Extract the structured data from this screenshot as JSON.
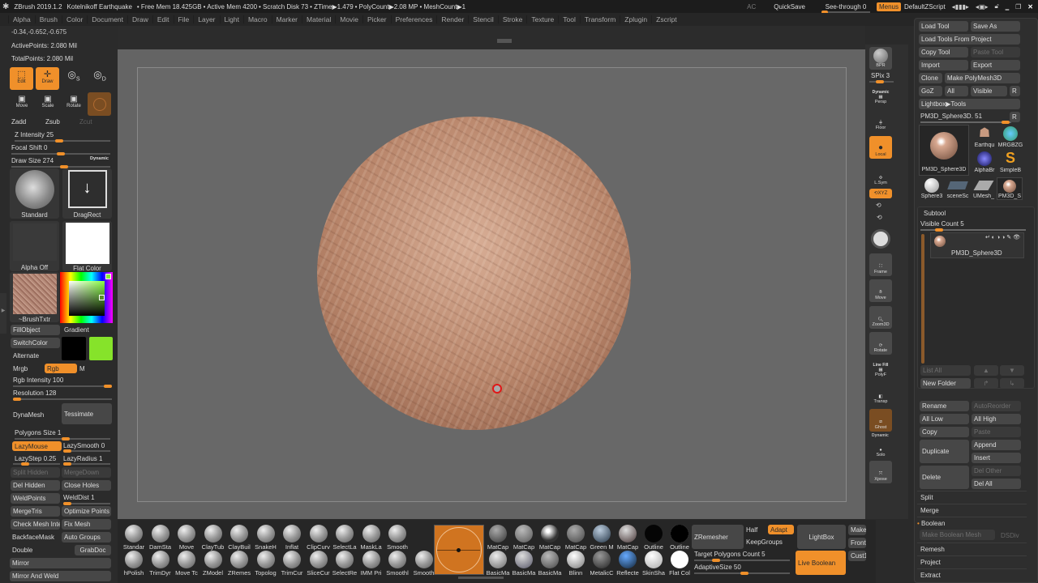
{
  "titlebar": {
    "app": "ZBrush 2019.1.2",
    "document": "Kotelnikoff Earthquake",
    "free_mem": "• Free Mem 18.425GB",
    "active_mem": "• Active Mem 4200",
    "scratch_disk": "• Scratch Disk 73",
    "ztime": "• ZTime▶1.479",
    "polycount": "• PolyCount▶2.08 MP",
    "meshcount": "• MeshCount▶1",
    "ac": "AC",
    "quicksave": "QuickSave",
    "see_through": "See-through  0",
    "see_through_value": 0,
    "menus": "Menus",
    "default_zscript": "DefaultZScript"
  },
  "menubar": [
    "Alpha",
    "Brush",
    "Color",
    "Document",
    "Draw",
    "Edit",
    "File",
    "Layer",
    "Light",
    "Macro",
    "Marker",
    "Material",
    "Movie",
    "Picker",
    "Preferences",
    "Render",
    "Stencil",
    "Stroke",
    "Texture",
    "Tool",
    "Transform",
    "Zplugin",
    "Zscript"
  ],
  "left": {
    "coords": "-0.34,-0.652,-0.675",
    "active_points": "ActivePoints: 2.080 Mil",
    "total_points": "TotalPoints: 2.080 Mil",
    "modes": [
      "Edit",
      "Draw",
      "S",
      "D"
    ],
    "transforms": [
      "Move",
      "Scale",
      "Rotate"
    ],
    "zadd": "Zadd",
    "zsub": "Zsub",
    "zcut": "Zcut",
    "z_intensity": "Z Intensity 25",
    "z_intensity_value": 25,
    "focal_shift": "Focal Shift 0",
    "focal_shift_value": 0,
    "draw_size": "Draw Size 274",
    "draw_size_value": 274,
    "dynamic": "Dynamic",
    "brush_name": "Standard",
    "stroke_name": "DragRect",
    "alpha_name": "Alpha Off",
    "texture_name": "Flat Color",
    "brush_texture": "~BrushTxtr",
    "fill_object": "FillObject",
    "gradient": "Gradient",
    "switch_color": "SwitchColor",
    "alternate": "Alternate",
    "main_color": "#000000",
    "secondary_color": "#86e32a",
    "mrgb": "Mrgb",
    "rgb": "Rgb",
    "m": "M",
    "rgb_intensity": "Rgb Intensity 100",
    "rgb_intensity_value": 100,
    "resolution": "Resolution 128",
    "resolution_value": 128,
    "dynamesh": "DynaMesh",
    "tessimate": "Tessimate",
    "polygons_size": "Polygons Size 1",
    "lazymouse": "LazyMouse",
    "lazysmooth": "LazySmooth 0",
    "lazystep": "LazyStep 0.25",
    "lazyradius": "LazyRadius 1",
    "split_hidden": "Split Hidden",
    "merge_down": "MergeDown",
    "del_hidden": "Del Hidden",
    "close_holes": "Close Holes",
    "weld_points": "WeldPoints",
    "weld_dist": "WeldDist 1",
    "merge_tris": "MergeTris",
    "optimize_points": "Optimize Points",
    "check_mesh": "Check Mesh Inte",
    "fix_mesh": "Fix Mesh",
    "backface_mask": "BackfaceMask",
    "auto_groups": "Auto Groups",
    "double": "Double",
    "grabdoc": "GrabDoc",
    "mirror": "Mirror",
    "mirror_and_weld": "Mirror And Weld"
  },
  "righttools": {
    "bpr": "BPR",
    "spix": "SPix 3",
    "persp": "Persp",
    "persp_dyn": "Dynamic",
    "floor": "Floor",
    "local": "Local",
    "lsym": "L.Sym",
    "xyz": "XYZ",
    "frame": "Frame",
    "move": "Move",
    "zoom3d": "Zoom3D",
    "rotate": "Rotate",
    "line_fill": "Line Fill",
    "polyf": "PolyF",
    "transp": "Transp",
    "ghost": "Ghost",
    "solo_dyn": "Dynamic",
    "solo": "Solo",
    "xpose": "Xpose"
  },
  "tool": {
    "load_tool": "Load Tool",
    "save_as": "Save As",
    "load_from_project": "Load Tools From Project",
    "copy_tool": "Copy Tool",
    "paste_tool": "Paste Tool",
    "import": "Import",
    "export": "Export",
    "clone": "Clone",
    "make_polymesh": "Make PolyMesh3D",
    "goz": "GoZ",
    "all": "All",
    "visible": "Visible",
    "r": "R",
    "lightbox_tools": "Lightbox▶Tools",
    "current": "PM3D_Sphere3D. 51",
    "current_value": 51,
    "thumbs": [
      {
        "label": "PM3D_Sphere3D",
        "badge": ""
      },
      {
        "label": "Earthqu",
        "badge": "8"
      },
      {
        "label": "MRGBZG",
        "badge": ""
      },
      {
        "label": "AlphaBr",
        "badge": ""
      },
      {
        "label": "SimpleB",
        "badge": ""
      },
      {
        "label": "Sphere3",
        "badge": ""
      },
      {
        "label": "sceneSc",
        "badge": "3"
      },
      {
        "label": "UMesh_",
        "badge": "86"
      },
      {
        "label": "PM3D_S",
        "badge": ""
      }
    ]
  },
  "subtool": {
    "title": "Subtool",
    "visible_count": "Visible Count 5",
    "visible_count_value": 5,
    "item": "PM3D_Sphere3D",
    "list_all": "List All",
    "new_folder": "New Folder",
    "rename": "Rename",
    "auto_reorder": "AutoReorder",
    "all_low": "All Low",
    "all_high": "All High",
    "copy": "Copy",
    "paste": "Paste",
    "duplicate": "Duplicate",
    "append": "Append",
    "insert": "Insert",
    "delete": "Delete",
    "del_other": "Del Other",
    "del_all": "Del All",
    "sections": [
      "Split",
      "Merge",
      "Boolean"
    ],
    "make_boolean_mesh": "Make Boolean Mesh",
    "dsdiv": "DSDiv",
    "sections2": [
      "Remesh",
      "Project",
      "Extract"
    ]
  },
  "bottom": {
    "brushes_row1": [
      "Standar",
      "DamSta",
      "Move",
      "ClayTub",
      "ClayBuil",
      "SnakeH",
      "Inflat",
      "ClipCurv",
      "SelectLa",
      "MaskLa",
      "Smooth"
    ],
    "brushes_row2": [
      "hPolish",
      "TrimDyr",
      "Move Tc",
      "ZModel",
      "ZRemes",
      "Topolog",
      "TrimCur",
      "SliceCur",
      "SelectRe",
      "IMM Pri",
      "Smoothl",
      "Smooth"
    ],
    "materials_row1": [
      "MatCap",
      "MatCap",
      "MatCap",
      "MatCap",
      "Green M",
      "MatCap",
      "Outline",
      "Outline"
    ],
    "materials_row2": [
      "BasicMa",
      "BasicMa",
      "BasicMa",
      "Blinn",
      "MetalicC",
      "Reflecte",
      "SkinSha",
      "Flat Col"
    ],
    "zremesher": "ZRemesher",
    "half": "Half",
    "adapt": "Adapt",
    "keep_groups": "KeepGroups",
    "lightbox": "LightBox",
    "target_polygons": "Target Polygons Count 5",
    "target_polygons_value": 5,
    "adaptive_size": "AdaptiveSize 50",
    "adaptive_size_value": 50,
    "live_boolean": "Live Boolean",
    "make": "Make",
    "front": "Front",
    "cust1": "Cust1"
  }
}
